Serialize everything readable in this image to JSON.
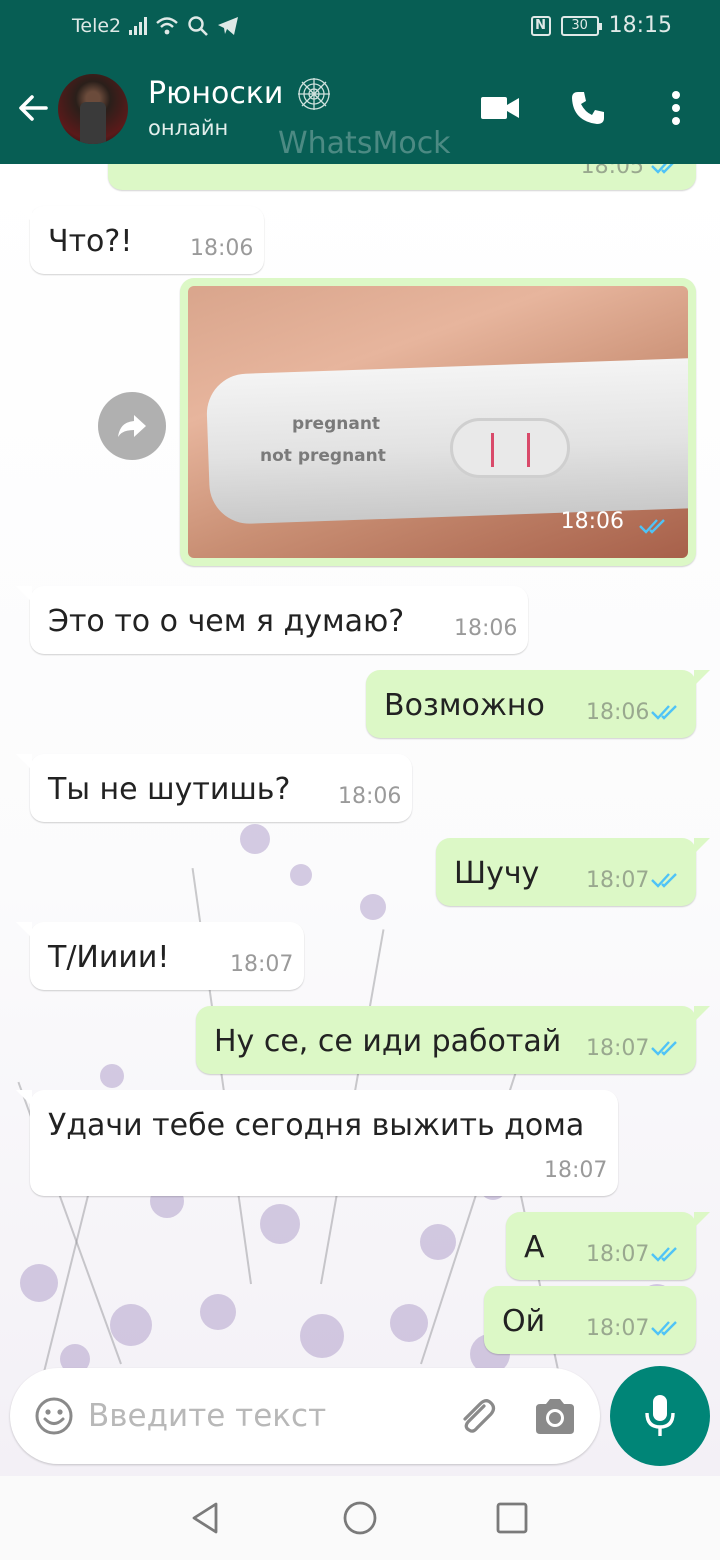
{
  "status_bar": {
    "carrier": "Tele2",
    "battery": "30",
    "time": "18:15"
  },
  "header": {
    "contact_name": "Рюноски",
    "contact_status": "онлайн",
    "watermark": "WhatsMock"
  },
  "messages": [
    {
      "dir": "out",
      "type": "text",
      "text": "",
      "time": "18:05",
      "ticks": "read",
      "partial": true
    },
    {
      "dir": "in",
      "type": "text",
      "text": "Что?!",
      "time": "18:06"
    },
    {
      "dir": "out",
      "type": "image",
      "labels": [
        "pregnant",
        "not pregnant"
      ],
      "time": "18:06",
      "ticks": "read"
    },
    {
      "dir": "in",
      "type": "text",
      "text": "Это то о чем я думаю?",
      "time": "18:06"
    },
    {
      "dir": "out",
      "type": "text",
      "text": "Возможно",
      "time": "18:06",
      "ticks": "read"
    },
    {
      "dir": "in",
      "type": "text",
      "text": "Ты не шутишь?",
      "time": "18:06"
    },
    {
      "dir": "out",
      "type": "text",
      "text": "Шучу",
      "time": "18:07",
      "ticks": "read"
    },
    {
      "dir": "in",
      "type": "text",
      "text": "Т/Ииии!",
      "time": "18:07"
    },
    {
      "dir": "out",
      "type": "text",
      "text": "Ну се, се иди работай",
      "time": "18:07",
      "ticks": "read"
    },
    {
      "dir": "in",
      "type": "text",
      "text": "Удачи тебе сегодня выжить дома",
      "time": "18:07"
    },
    {
      "dir": "out",
      "type": "text",
      "text": "А",
      "time": "18:07",
      "ticks": "read"
    },
    {
      "dir": "out",
      "type": "text",
      "text": "Ой",
      "time": "18:07",
      "ticks": "read"
    }
  ],
  "composer": {
    "placeholder": "Введите текст"
  },
  "colors": {
    "header": "#075e54",
    "outgoing_bubble": "#dcf8c6",
    "incoming_bubble": "#ffffff",
    "read_ticks": "#4fc3f7",
    "mic_button": "#008577"
  },
  "icons": [
    "back-arrow-icon",
    "spiderweb-icon",
    "video-call-icon",
    "phone-icon",
    "more-menu-icon",
    "forward-icon",
    "emoji-icon",
    "attach-icon",
    "camera-icon",
    "mic-icon",
    "nav-back-icon",
    "nav-home-icon",
    "nav-recents-icon"
  ]
}
